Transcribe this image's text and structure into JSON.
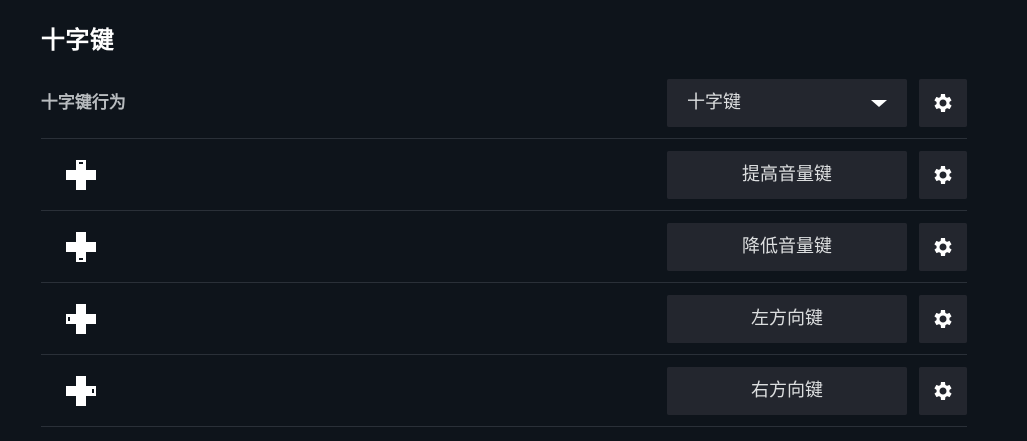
{
  "section": {
    "title": "十字键"
  },
  "behavior_row": {
    "label": "十字键行为",
    "dropdown_value": "十字键"
  },
  "bindings": [
    {
      "direction": "up",
      "icon": "dpad-up-icon",
      "binding": "提高音量键"
    },
    {
      "direction": "down",
      "icon": "dpad-down-icon",
      "binding": "降低音量键"
    },
    {
      "direction": "left",
      "icon": "dpad-left-icon",
      "binding": "左方向键"
    },
    {
      "direction": "right",
      "icon": "dpad-right-icon",
      "binding": "右方向键"
    }
  ],
  "icons": {
    "settings": "gear-icon",
    "dropdown": "caret-down-icon"
  },
  "colors": {
    "background": "#0e141b",
    "button": "#23262e",
    "divider": "#2a3038",
    "label": "#b8bcbf",
    "text": "#dcdedf"
  }
}
